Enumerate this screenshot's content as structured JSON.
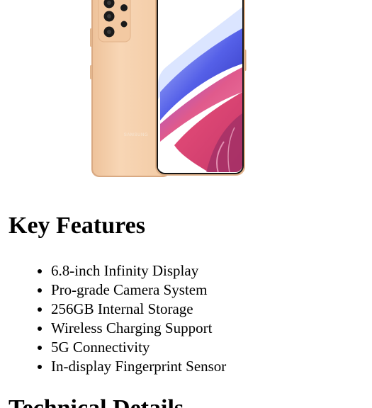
{
  "product": {
    "image_alt": "Peach Samsung smartphone shown front and back",
    "brand_mark": "SAMSUNG"
  },
  "key_features": {
    "title": "Key Features",
    "items": [
      "6.8-inch Infinity Display",
      "Pro-grade Camera System",
      "256GB Internal Storage",
      "Wireless Charging Support",
      "5G Connectivity",
      "In-display Fingerprint Sensor"
    ]
  },
  "technical_details": {
    "title": "Technical Details"
  },
  "colors": {
    "phone_body": "#f6d1ae",
    "phone_edge": "#e8bb92",
    "screen_frame": "#141414"
  }
}
